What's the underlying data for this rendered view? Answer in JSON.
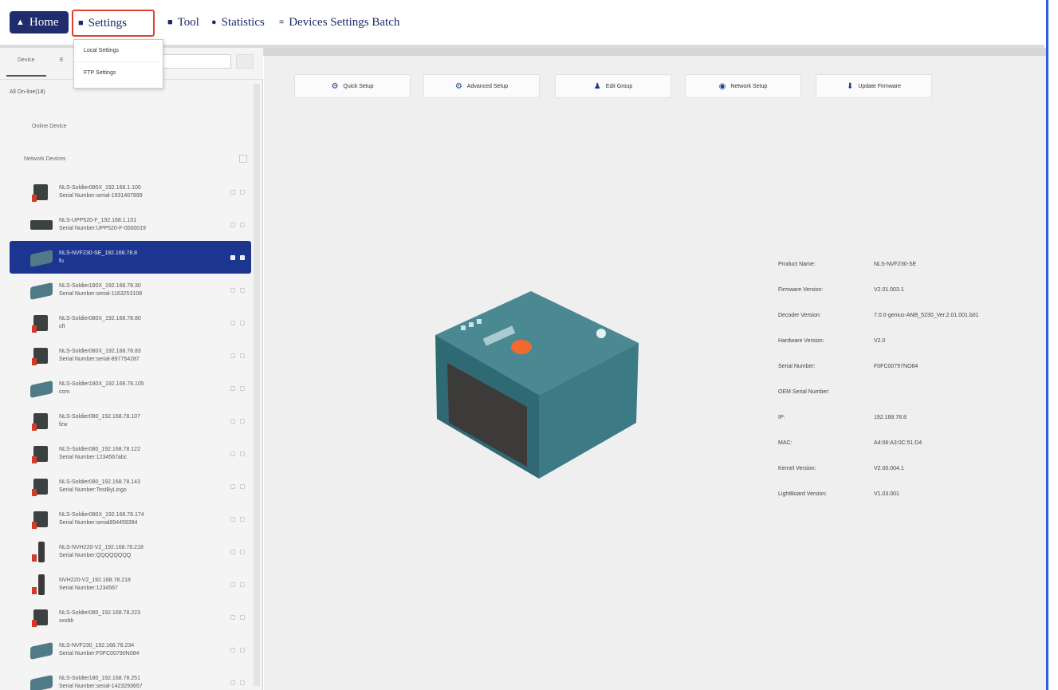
{
  "menu": {
    "home": "Home",
    "settings": "Settings",
    "tool": "Tool",
    "statistics": "Statistics",
    "devices_batch": "Devices Settings Batch"
  },
  "settings_dropdown": [
    "Local Settings",
    "FTP Settings"
  ],
  "left_panel": {
    "tabs": [
      "Device",
      "E"
    ],
    "root": "All On-line(18)",
    "online_device": "Online Device",
    "network_devices": "Network Devices",
    "devices": [
      {
        "line1": "NLS-Soldier080X_192.168.1.100",
        "line2": "Serial Number:serial-1931407899",
        "icon": "scanner"
      },
      {
        "line1": "NLS-UPP520-F_192.168.1.101",
        "line2": "Serial Number:UPP520-F-0000019",
        "icon": "flat"
      },
      {
        "line1": "NLS-NVF230-SE_192.168.78.8",
        "line2": "fu",
        "icon": "teal",
        "selected": true
      },
      {
        "line1": "NLS-Soldier180X_192.168.78.30",
        "line2": "Serial Number:serial-1163253108",
        "icon": "teal"
      },
      {
        "line1": "NLS-Soldier080X_192.168.78.80",
        "line2": "cft",
        "icon": "scanner"
      },
      {
        "line1": "NLS-Soldier080X_192.168.78.83",
        "line2": "Serial Number:serial-897754287",
        "icon": "scanner"
      },
      {
        "line1": "NLS-Soldier180X_192.168.78.105",
        "line2": "com",
        "icon": "teal"
      },
      {
        "line1": "NLS-Soldier080_192.168.78.107",
        "line2": "fzw",
        "icon": "scanner"
      },
      {
        "line1": "NLS-Soldier080_192.168.78.122",
        "line2": "Serial Number:1234567abc",
        "icon": "scanner"
      },
      {
        "line1": "NLS-Soldier080_192.168.78.143",
        "line2": "Serial Number:TestByLingo",
        "icon": "scanner"
      },
      {
        "line1": "NLS-Soldier080X_192.168.78.174",
        "line2": "Serial Number:serial894459394",
        "icon": "scanner"
      },
      {
        "line1": "NLS-NVH220-V2_192.168.78.218",
        "line2": "Serial Number:QQQQQQQQ",
        "icon": "gun"
      },
      {
        "line1": "NVH220-V2_192.168.78.218",
        "line2": "Serial Number:1234567",
        "icon": "gun"
      },
      {
        "line1": "NLS-Soldier080_192.168.78.223",
        "line2": "xxxbb",
        "icon": "scanner"
      },
      {
        "line1": "NLS-NVF230_192.168.78.234",
        "line2": "Serial Number:F0FC00790N084",
        "icon": "teal"
      },
      {
        "line1": "NLS-Soldier180_192.168.78.251",
        "line2": "Serial Number:serial-1423293657",
        "icon": "teal"
      }
    ]
  },
  "toolbar": {
    "quick_setup": "Quick Setup",
    "advanced_setup": "Advanced Setup",
    "edit_group": "Edit Group",
    "network_setup": "Network Setup",
    "update_firmware": "Update Firmware"
  },
  "info": [
    {
      "k": "Product Name:",
      "v": "NLS-NVF230-SE"
    },
    {
      "k": "Firmware Version:",
      "v": "V2.01.003.1"
    },
    {
      "k": "Decoder Version:",
      "v": "7.0.0-genius-ANB_5230_Ver.2.01.001.b01"
    },
    {
      "k": "Hardware Version:",
      "v": "V2.0"
    },
    {
      "k": "Serial Number:",
      "v": "F0FC00797NO84"
    },
    {
      "k": "OEM Serial Number:",
      "v": ""
    },
    {
      "k": "IP:",
      "v": "192.168.78.8"
    },
    {
      "k": "MAC:",
      "v": "A4:06:A3:0C:51:D4"
    },
    {
      "k": "Kernel Version:",
      "v": "V2.00.004.1"
    },
    {
      "k": "LightBoard Version:",
      "v": "V1.03.001"
    }
  ],
  "colors": {
    "accent": "#1c3690",
    "highlight_border": "#e2412f",
    "device_body": "#3f7b85"
  }
}
